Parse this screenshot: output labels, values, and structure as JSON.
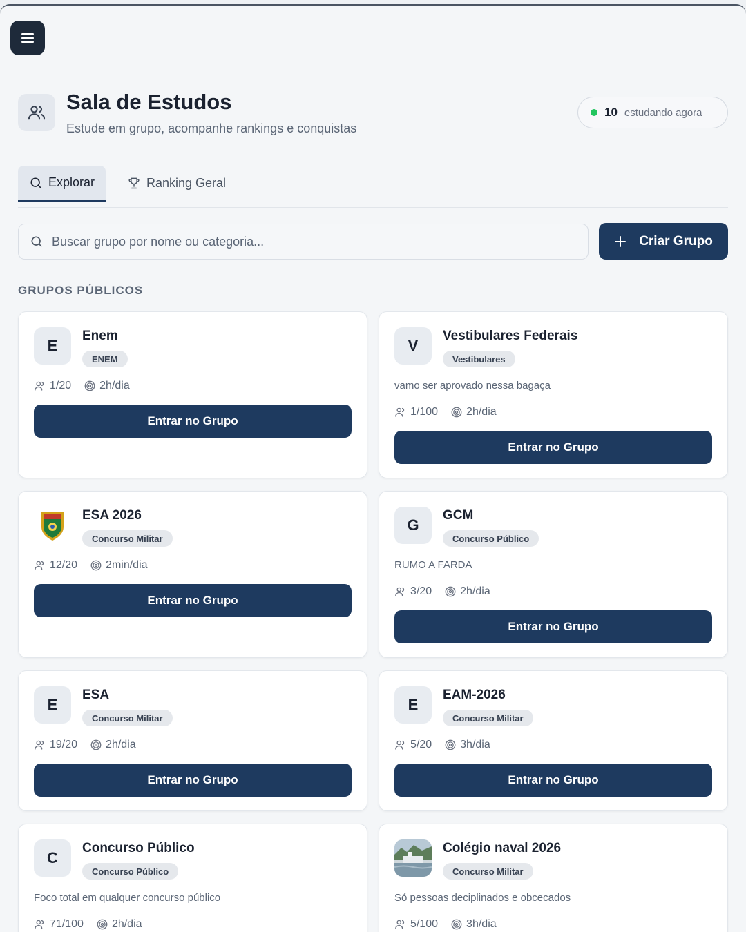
{
  "header": {
    "title": "Sala de Estudos",
    "subtitle": "Estude em grupo, acompanhe rankings e conquistas",
    "online_count": "10",
    "online_label": "estudando agora"
  },
  "tabs": [
    {
      "label": "Explorar",
      "icon": "search-icon",
      "active": true
    },
    {
      "label": "Ranking Geral",
      "icon": "trophy-icon",
      "active": false
    }
  ],
  "search": {
    "placeholder": "Buscar grupo por nome ou categoria..."
  },
  "create_button": {
    "label": "Criar Grupo"
  },
  "section_label": "GRUPOS PÚBLICOS",
  "groups": [
    {
      "initial": "E",
      "name": "Enem",
      "category": "ENEM",
      "description": "",
      "members": "1/20",
      "time": "2h/dia",
      "button": "Entrar no Grupo"
    },
    {
      "initial": "V",
      "name": "Vestibulares Federais",
      "category": "Vestibulares",
      "description": "vamo ser aprovado nessa bagaça",
      "members": "1/100",
      "time": "2h/dia",
      "button": "Entrar no Grupo"
    },
    {
      "initial": "",
      "name": "ESA 2026",
      "category": "Concurso Militar",
      "description": "",
      "members": "12/20",
      "time": "2min/dia",
      "button": "Entrar no Grupo",
      "image": "esa-crest"
    },
    {
      "initial": "G",
      "name": "GCM",
      "category": "Concurso Público",
      "description": "RUMO A FARDA",
      "members": "3/20",
      "time": "2h/dia",
      "button": "Entrar no Grupo"
    },
    {
      "initial": "E",
      "name": "ESA",
      "category": "Concurso Militar",
      "description": "",
      "members": "19/20",
      "time": "2h/dia",
      "button": "Entrar no Grupo"
    },
    {
      "initial": "E",
      "name": "EAM-2026",
      "category": "Concurso Militar",
      "description": "",
      "members": "5/20",
      "time": "3h/dia",
      "button": "Entrar no Grupo"
    },
    {
      "initial": "C",
      "name": "Concurso Público",
      "category": "Concurso Público",
      "description": "Foco total em qualquer concurso público",
      "members": "71/100",
      "time": "2h/dia",
      "button": "Entrar no Grupo"
    },
    {
      "initial": "",
      "name": "Colégio naval 2026",
      "category": "Concurso Militar",
      "description": "Só pessoas deciplinados e obcecados",
      "members": "5/100",
      "time": "3h/dia",
      "button": "Entrar no Grupo",
      "image": "ship-photo"
    }
  ],
  "colors": {
    "primary": "#1e3a5f",
    "online_dot": "#22c55e",
    "background": "#f4f6f8"
  }
}
